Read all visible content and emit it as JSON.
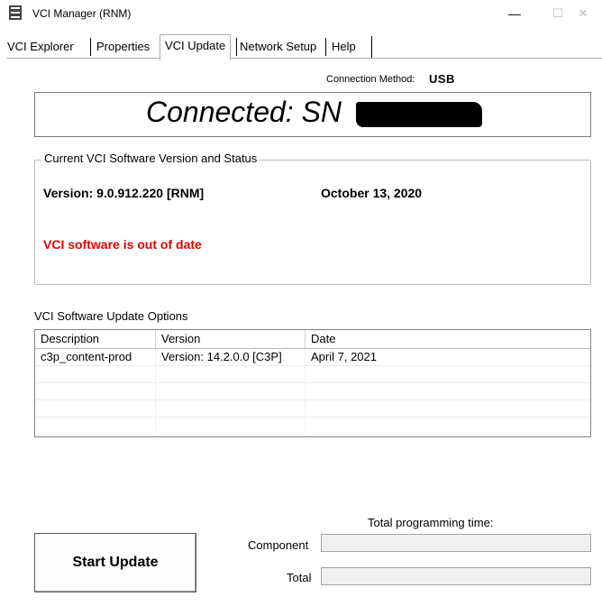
{
  "window": {
    "title": "VCI Manager (RNM)",
    "minimize_glyph": "—",
    "maximize_glyph": "☐",
    "close_glyph": "✕"
  },
  "tabs": [
    {
      "label": "VCI Explorer",
      "active": false
    },
    {
      "label": "Properties",
      "active": false
    },
    {
      "label": "VCI Update",
      "active": true
    },
    {
      "label": "Network Setup",
      "active": false
    },
    {
      "label": "Help",
      "active": false
    }
  ],
  "connection": {
    "method_label": "Connection Method:",
    "method_value": "USB",
    "status": "Connected: SN"
  },
  "current": {
    "group_title": "Current VCI Software Version and Status",
    "version": "Version: 9.0.912.220 [RNM]",
    "date": "October 13, 2020",
    "status_message": "VCI software is out of date",
    "status_color": "#e60000"
  },
  "options": {
    "title": "VCI Software Update Options",
    "columns": [
      "Description",
      "Version",
      "Date"
    ],
    "rows": [
      {
        "description": "c3p_content-prod",
        "version": "Version: 14.2.0.0 [C3P]",
        "date": "April 7, 2021"
      }
    ]
  },
  "update": {
    "button_label": "Start Update",
    "total_time_label": "Total programming time:",
    "component_label": "Component",
    "total_label": "Total"
  }
}
